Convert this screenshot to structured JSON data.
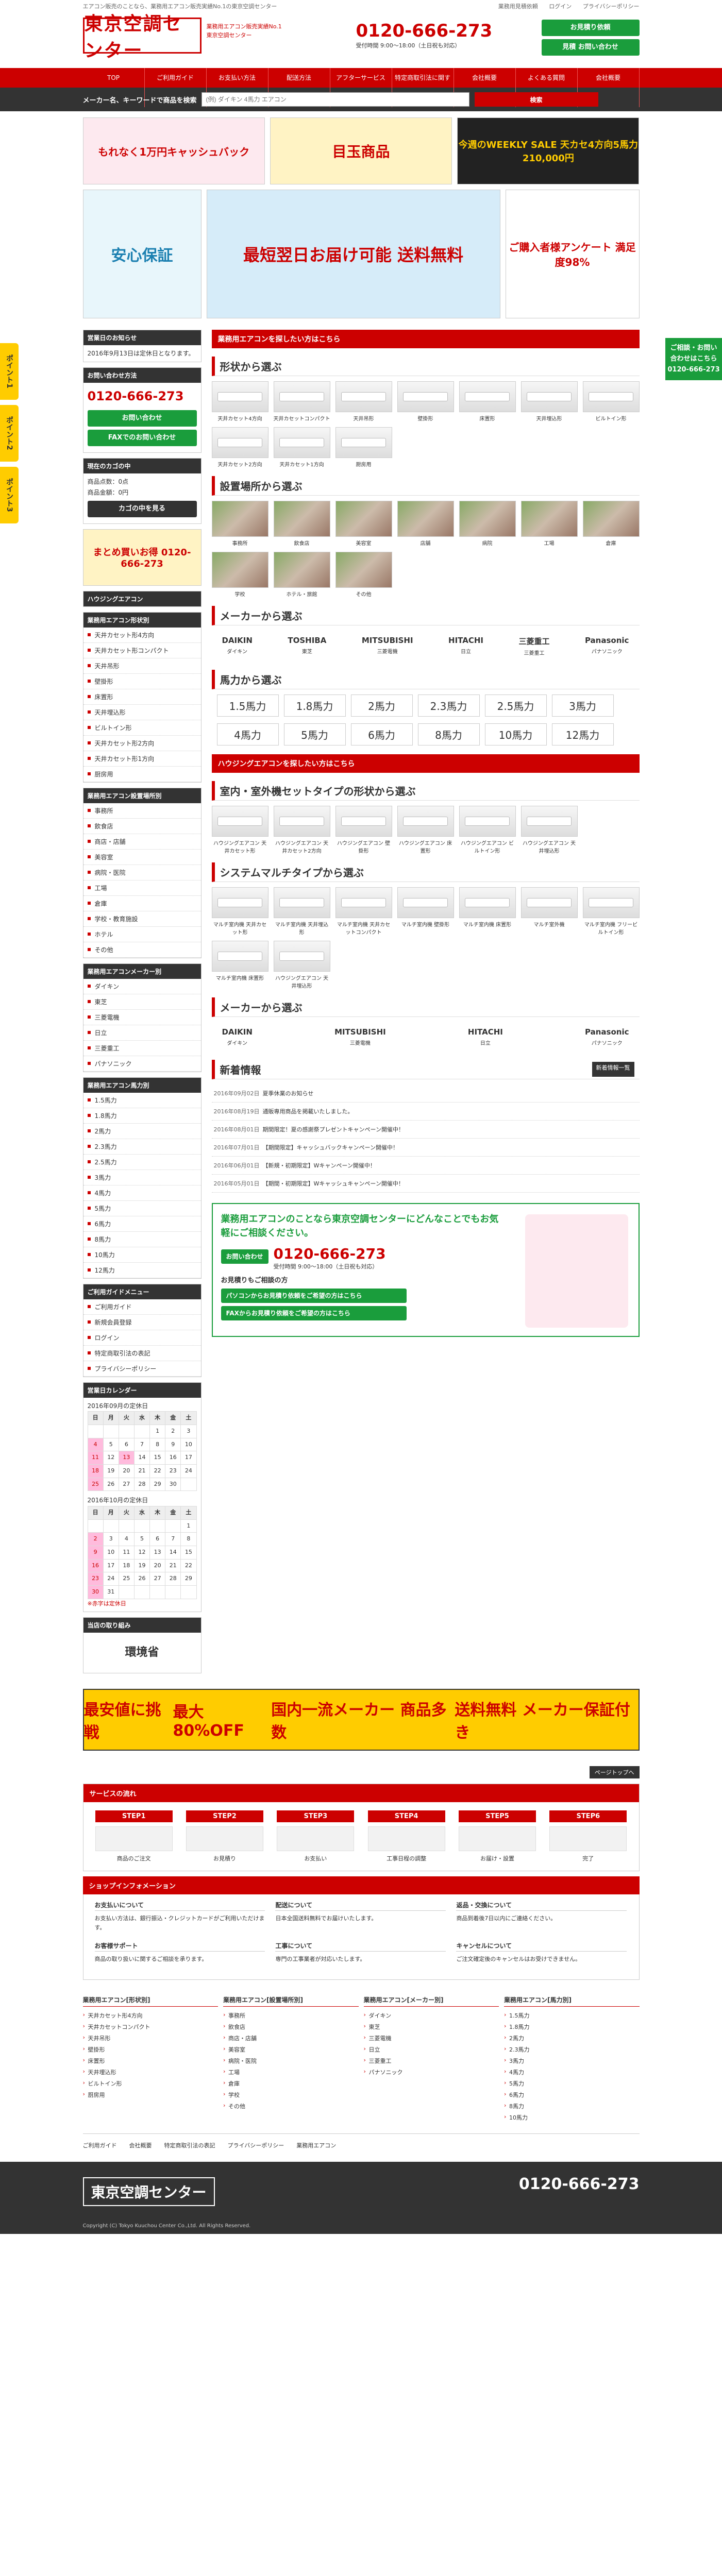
{
  "top": {
    "tagline": "エアコン販売のことなら、業務用エアコン販売実績No.1の東京空調センター",
    "links": [
      "業務用見積依頼",
      "ログイン",
      "プライバシーポリシー"
    ]
  },
  "header": {
    "logo": "東京空調センター",
    "logo_sub": "業務用エアコン販売実績No.1\n東京空調センター",
    "tel": "0120-666-273",
    "hours": "受付時間 9:00〜18:00（土日祝も対応）",
    "btn_estimate": "お見積り依頼",
    "btn_contact": "見積 お問い合わせ"
  },
  "nav": [
    "TOP",
    "ご利用ガイド",
    "お支払い方法",
    "配送方法",
    "アフターサービス",
    "特定商取引法に関する表記",
    "会社概要",
    "よくある質問",
    "会社概要"
  ],
  "search": {
    "label": "メーカー名、キーワードで商品を検索",
    "placeholder": "(例) ダイキン 4馬力 エアコン",
    "button": "検索"
  },
  "banners": {
    "b1": "もれなく1万円キャッシュバック",
    "b2": "目玉商品",
    "b3": "今週のWEEKLY SALE 天カセ4方向5馬力 210,000円",
    "b4": "安心保証",
    "b5": "最短翌日お届け可能 送料無料",
    "b6": "ご購入者様アンケート 満足度98%"
  },
  "side_tabs": [
    "ポイント1",
    "ポイント2",
    "ポイント3"
  ],
  "side_right": "ご相談・お問い合わせはこちら 0120-666-273",
  "sidebar": {
    "hours_h": "営業日のお知らせ",
    "hours_b": "2016年9月13日は定休日となります。",
    "contact_h": "お問い合わせ方法",
    "contact_tel": "0120-666-273",
    "contact_btn": "お問い合わせ",
    "fax_btn": "FAXでのお問い合わせ",
    "cart_h": "現在のカゴの中",
    "cart_count": "商品点数：0点",
    "cart_total": "商品金額：0円",
    "cart_btn": "カゴの中を見る",
    "ban": "まとめ買いお得 0120-666-273",
    "cat1_h": "ハウジングエアコン",
    "cat2_h": "業務用エアコン形状別",
    "cat2": [
      "天井カセット形4方向",
      "天井カセット形コンパクト",
      "天井吊形",
      "壁掛形",
      "床置形",
      "天井埋込形",
      "ビルトイン形",
      "天井カセット形2方向",
      "天井カセット形1方向",
      "厨房用"
    ],
    "cat3_h": "業務用エアコン設置場所別",
    "cat3": [
      "事務所",
      "飲食店",
      "商店・店舗",
      "美容室",
      "病院・医院",
      "工場",
      "倉庫",
      "学校・教育施設",
      "ホテル",
      "その他"
    ],
    "cat4_h": "業務用エアコンメーカー別",
    "cat4": [
      "ダイキン",
      "東芝",
      "三菱電機",
      "日立",
      "三菱重工",
      "パナソニック"
    ],
    "cat5_h": "業務用エアコン馬力別",
    "cat5": [
      "1.5馬力",
      "1.8馬力",
      "2馬力",
      "2.3馬力",
      "2.5馬力",
      "3馬力",
      "4馬力",
      "5馬力",
      "6馬力",
      "8馬力",
      "10馬力",
      "12馬力"
    ],
    "guide_h": "ご利用ガイドメニュー",
    "guide": [
      "ご利用ガイド",
      "新規会員登録",
      "ログイン",
      "特定商取引法の表記",
      "プライバシーポリシー"
    ],
    "cal_h": "営業日カレンダー",
    "cal_m1": "2016年09月の定休日",
    "cal_m2": "2016年10月の定休日",
    "wd": [
      "日",
      "月",
      "火",
      "水",
      "木",
      "金",
      "土"
    ],
    "cal_note": "※赤字は定休日",
    "env_h": "当店の取り組み",
    "env": "環境省"
  },
  "content": {
    "sec1": "業務用エアコンを探したい方はこちら",
    "shape_h": "形状から選ぶ",
    "shapes": [
      "天井カセット4方向",
      "天井カセットコンパクト",
      "天井吊形",
      "壁掛形",
      "床置形",
      "天井埋込形",
      "ビルトイン形",
      "天井カセット2方向",
      "天井カセット1方向",
      "厨房用"
    ],
    "place_h": "設置場所から選ぶ",
    "places": [
      "事務所",
      "飲食店",
      "美容室",
      "店舗",
      "病院",
      "工場",
      "倉庫",
      "学校",
      "ホテル・旅館",
      "その他"
    ],
    "maker_h": "メーカーから選ぶ",
    "makers": [
      {
        "n": "DAIKIN",
        "s": "ダイキン"
      },
      {
        "n": "TOSHIBA",
        "s": "東芝"
      },
      {
        "n": "MITSUBISHI",
        "s": "三菱電機"
      },
      {
        "n": "HITACHI",
        "s": "日立"
      },
      {
        "n": "三菱重工",
        "s": "三菱重工"
      },
      {
        "n": "Panasonic",
        "s": "パナソニック"
      }
    ],
    "hp_h": "馬力から選ぶ",
    "hps": [
      "1.5馬力",
      "1.8馬力",
      "2馬力",
      "2.3馬力",
      "2.5馬力",
      "3馬力",
      "4馬力",
      "5馬力",
      "6馬力",
      "8馬力",
      "10馬力",
      "12馬力"
    ],
    "sec2": "ハウジングエアコンを探したい方はこちら",
    "h_shape_h": "室内・室外機セットタイプの形状から選ぶ",
    "h_shapes": [
      "ハウジングエアコン 天井カセット形",
      "ハウジングエアコン 天井カセット2方向",
      "ハウジングエアコン 壁掛形",
      "ハウジングエアコン 床置形",
      "ハウジングエアコン ビルトイン形",
      "ハウジングエアコン 天井埋込形"
    ],
    "multi_h": "システムマルチタイプから選ぶ",
    "multis": [
      "マルチ室内機 天井カセット形",
      "マルチ室内機 天井埋込形",
      "マルチ室内機 天井カセットコンパクト",
      "マルチ室内機 壁掛形",
      "マルチ室内機 床置形",
      "マルチ室外機",
      "マルチ室内機 フリービルトイン形",
      "マルチ室内機 床置形",
      "ハウジングエアコン 天井埋込形"
    ],
    "h_maker_h": "メーカーから選ぶ",
    "h_makers": [
      {
        "n": "DAIKIN",
        "s": "ダイキン"
      },
      {
        "n": "MITSUBISHI",
        "s": "三菱電機"
      },
      {
        "n": "HITACHI",
        "s": "日立"
      },
      {
        "n": "Panasonic",
        "s": "パナソニック"
      }
    ],
    "news_h": "新着情報",
    "news_btn": "新着情報一覧",
    "news": [
      {
        "d": "2016年09月02日",
        "t": "夏季休業のお知らせ"
      },
      {
        "d": "2016年08月19日",
        "t": "通販専用商品を掲載いたしました。"
      },
      {
        "d": "2016年08月01日",
        "t": "期間限定！夏の感謝祭プレゼントキャンペーン開催中！"
      },
      {
        "d": "2016年07月01日",
        "t": "【期間限定】キャッシュバックキャンペーン開催中！"
      },
      {
        "d": "2016年06月01日",
        "t": "【新規・初期限定】Wキャンペーン開催中！"
      },
      {
        "d": "2016年05月01日",
        "t": "【期間・初期限定】Wキャッシュキャンペーン開催中！"
      }
    ],
    "contact_intro": "業務用エアコンのことなら東京空調センターにどんなことでもお気軽にご相談ください。",
    "contact_tel": "0120-666-273",
    "contact_hours": "受付時間 9:00〜18:00（土日祝も対応）",
    "contact_btn": "お問い合わせ",
    "contact_sub": "お見積りもご相談の方",
    "cb1": "パソコンからお見積り依頼をご希望の方はこちら",
    "cb2": "FAXからお見積り依頼をご希望の方はこちら",
    "bottom_banner": [
      "最安値に挑戦",
      "最大80%OFF",
      "国内一流メーカー 商品多数",
      "送料無料 メーカー保証付き"
    ],
    "pagetop": "ページトップへ"
  },
  "flow": {
    "h": "サービスの流れ",
    "steps": [
      {
        "n": "STEP1",
        "t": "商品のご注文"
      },
      {
        "n": "STEP2",
        "t": "お見積り"
      },
      {
        "n": "STEP3",
        "t": "お支払い"
      },
      {
        "n": "STEP4",
        "t": "工事日程の調整"
      },
      {
        "n": "STEP5",
        "t": "お届け・設置"
      },
      {
        "n": "STEP6",
        "t": "完了"
      }
    ]
  },
  "info": {
    "h": "ショップインフォメーション",
    "cols": [
      {
        "h": "お支払いについて",
        "t": "お支払い方法は、銀行振込・クレジットカードがご利用いただけます。"
      },
      {
        "h": "配送について",
        "t": "日本全国送料無料でお届けいたします。"
      },
      {
        "h": "返品・交換について",
        "t": "商品到着後7日以内にご連絡ください。"
      },
      {
        "h": "お客様サポート",
        "t": "商品の取り扱いに関するご相談を承ります。"
      },
      {
        "h": "工事について",
        "t": "専門の工事業者が対応いたします。"
      },
      {
        "h": "キャンセルについて",
        "t": "ご注文確定後のキャンセルはお受けできません。"
      }
    ]
  },
  "foot": {
    "cols": [
      {
        "h": "業務用エアコン[形状別]",
        "items": [
          "天井カセット形4方向",
          "天井カセットコンパクト",
          "天井吊形",
          "壁掛形",
          "床置形",
          "天井埋込形",
          "ビルトイン形",
          "厨房用"
        ]
      },
      {
        "h": "業務用エアコン[設置場所別]",
        "items": [
          "事務所",
          "飲食店",
          "商店・店舗",
          "美容室",
          "病院・医院",
          "工場",
          "倉庫",
          "学校",
          "その他"
        ]
      },
      {
        "h": "業務用エアコン[メーカー別]",
        "items": [
          "ダイキン",
          "東芝",
          "三菱電機",
          "日立",
          "三菱重工",
          "パナソニック"
        ]
      },
      {
        "h": "業務用エアコン[馬力別]",
        "items": [
          "1.5馬力",
          "1.8馬力",
          "2馬力",
          "2.3馬力",
          "3馬力",
          "4馬力",
          "5馬力",
          "6馬力",
          "8馬力",
          "10馬力"
        ]
      }
    ],
    "links": [
      "ご利用ガイド",
      "会社概要",
      "特定商取引法の表記",
      "プライバシーポリシー",
      "業務用エアコン"
    ],
    "logo": "東京空調センター",
    "tel": "0120-666-273",
    "copy": "Copyright (C) Tokyo Kuuchou Center Co.,Ltd. All Rights Reserved."
  }
}
